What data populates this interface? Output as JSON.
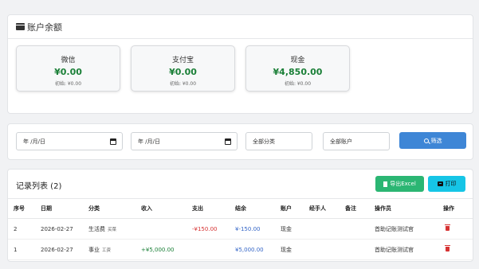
{
  "balance": {
    "title": "账户余额",
    "accounts": [
      {
        "name": "微信",
        "amount": "¥0.00",
        "initial": "初始: ¥0.00"
      },
      {
        "name": "支付宝",
        "amount": "¥0.00",
        "initial": "初始: ¥0.00"
      },
      {
        "name": "现金",
        "amount": "¥4,850.00",
        "initial": "初始: ¥0.00"
      }
    ]
  },
  "filter": {
    "date_start": "年 /月/日",
    "date_end": "年 /月/日",
    "category": "全部分类",
    "account": "全部账户",
    "submit": "筛选"
  },
  "records": {
    "title": "记录列表 (2)",
    "export_label": "导出Excel",
    "print_label": "打印",
    "headers": [
      "序号",
      "日期",
      "分类",
      "收入",
      "支出",
      "结余",
      "账户",
      "经手人",
      "备注",
      "操作员",
      "操作"
    ],
    "rows": [
      {
        "no": "2",
        "date": "2026-02-27",
        "category": "生活费",
        "sub": "买菜",
        "income": "",
        "expense": "-¥150.00",
        "balance": "¥-150.00",
        "account": "现金",
        "handler": "",
        "note": "",
        "operator": "首助记账测试官"
      },
      {
        "no": "1",
        "date": "2026-02-27",
        "category": "事业",
        "sub": "工资",
        "income": "+¥5,000.00",
        "expense": "",
        "balance": "¥5,000.00",
        "account": "现金",
        "handler": "",
        "note": "",
        "operator": "首助记账测试官"
      }
    ]
  },
  "colors": {
    "income": "#1a7f37",
    "expense": "#d63333",
    "balance": "#3566c7",
    "primary": "#3e86d6",
    "success": "#2bb673",
    "info": "#16c5e6"
  }
}
